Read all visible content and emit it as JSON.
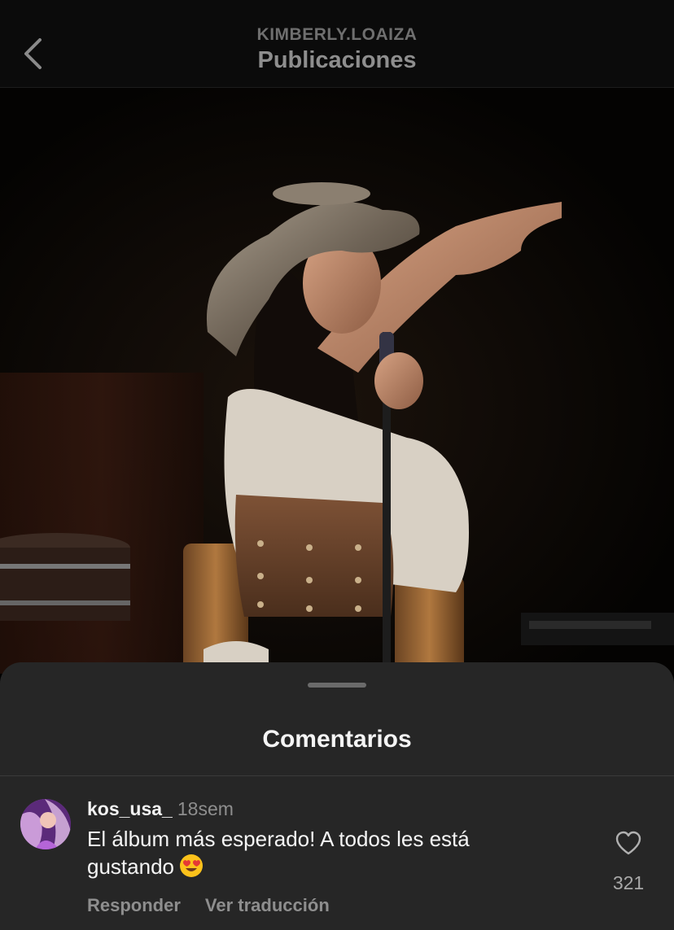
{
  "header": {
    "username": "KIMBERLY.LOAIZA",
    "title": "Publicaciones"
  },
  "icons": {
    "back": "chevron-left-icon",
    "like": "heart-outline-icon",
    "emoji": "heart-eyes-emoji"
  },
  "comments_sheet": {
    "title": "Comentarios",
    "comments": [
      {
        "username": "kos_usa_",
        "time": "18sem",
        "text": "El álbum más esperado! A todos les está gustando",
        "likes": "321",
        "reply_label": "Responder",
        "translate_label": "Ver traducción"
      }
    ]
  },
  "colors": {
    "background": "#000000",
    "sheet": "#262626",
    "text_primary": "#f5f5f5",
    "text_secondary": "#8e8e8e"
  }
}
